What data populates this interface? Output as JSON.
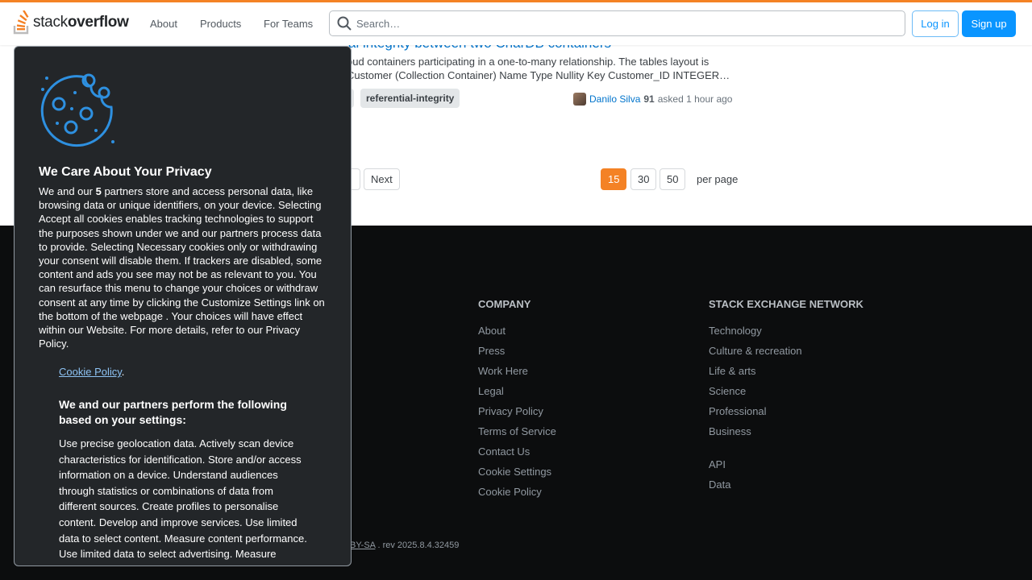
{
  "header": {
    "logo_text_light": "stack",
    "logo_text_bold": "overflow",
    "nav": [
      "About",
      "Products",
      "For Teams"
    ],
    "search_placeholder": "Search…",
    "login_label": "Log in",
    "signup_label": "Sign up",
    "accent_color": "#f48225"
  },
  "question": {
    "title": "al integrity between two CharDB containers",
    "excerpt_line1": "oud containers participating in a one-to-many relationship. The tables layout is",
    "excerpt_line2": "Customer (Collection Container) Name Type Nullity Key Customer_ID INTEGER…",
    "tag": "referential-integrity",
    "owner_name": "Danilo Silva",
    "owner_rep": "91",
    "asked": "asked 1 hour ago"
  },
  "pager": {
    "next_label": "Next",
    "page_sizes": [
      "15",
      "30",
      "50"
    ],
    "current_size": "15",
    "per_page_label": "per page"
  },
  "footer": {
    "company_heading": "COMPANY",
    "company_links": [
      "About",
      "Press",
      "Work Here",
      "Legal",
      "Privacy Policy",
      "Terms of Service",
      "Contact Us",
      "Cookie Settings",
      "Cookie Policy"
    ],
    "network_heading": "STACK EXCHANGE NETWORK",
    "network_links": [
      "Technology",
      "Culture & recreation",
      "Life & arts",
      "Science",
      "Professional",
      "Business"
    ],
    "network_extra": [
      "API",
      "Data"
    ],
    "license_fragment": "BY-SA",
    "revision": ". rev 2025.8.4.32459"
  },
  "privacy": {
    "heading": "We Care About Your Privacy",
    "body_prefix": "We and our ",
    "partners_count": "5",
    "body_suffix": " partners store and access personal data, like browsing data or unique identifiers, on your device. Selecting Accept all cookies enables tracking technologies to support the purposes shown under we and our partners process data to provide. Selecting Necessary cookies only or withdrawing your consent will disable them. If trackers are disabled, some content and ads you see may not be as relevant to you. You can resurface this menu to change your choices or withdraw consent at any time by clicking the Customize Settings link on the bottom of the webpage . Your choices will have effect within our Website. For more details, refer to our Privacy Policy.",
    "cookie_policy_link": "Cookie Policy",
    "cookie_policy_suffix": ".",
    "purposes_heading": "We and our partners perform the following based on your settings:",
    "purposes_text": "Use precise geolocation data. Actively scan device characteristics for identification. Store and/or access information on a device. Understand audiences through statistics or combinations of data from different sources. Create profiles to personalise content. Develop and improve services. Use limited data to select content. Measure content performance. Use limited data to select advertising. Measure advertising performance. Create profiles for personalised advertising.",
    "icon": "cookie-icon"
  }
}
